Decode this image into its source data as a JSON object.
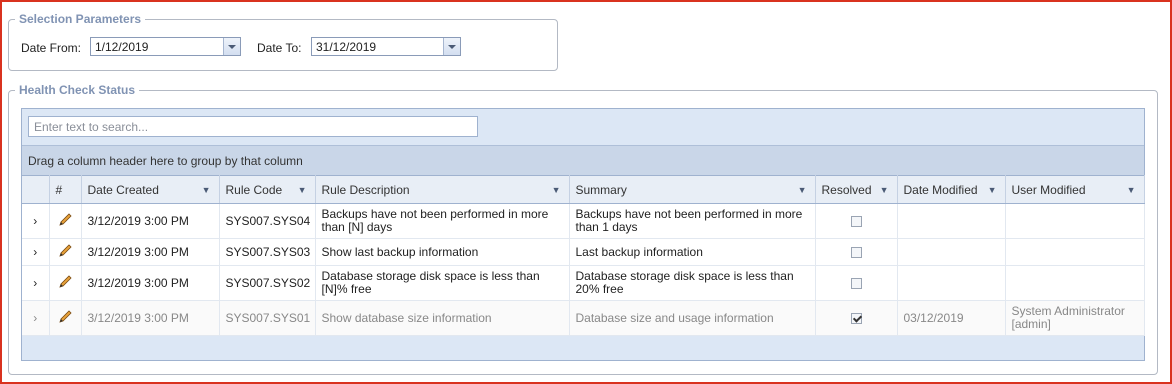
{
  "selection": {
    "legend": "Selection Parameters",
    "date_from_label": "Date From:",
    "date_from_value": "1/12/2019",
    "date_to_label": "Date To:",
    "date_to_value": "31/12/2019"
  },
  "health": {
    "legend": "Health Check Status",
    "search_placeholder": "Enter text to search...",
    "group_hint": "Drag a column header here to group by that column",
    "columns": {
      "num": "#",
      "date_created": "Date Created",
      "rule_code": "Rule Code",
      "rule_description": "Rule Description",
      "summary": "Summary",
      "resolved": "Resolved",
      "date_modified": "Date Modified",
      "user_modified": "User Modified"
    },
    "rows": [
      {
        "date_created": "3/12/2019 3:00 PM",
        "rule_code": "SYS007.SYS04",
        "rule_description": "Backups have not been performed in more than [N] days",
        "summary": "Backups have not been performed in more than 1 days",
        "resolved": false,
        "date_modified": "",
        "user_modified": ""
      },
      {
        "date_created": "3/12/2019 3:00 PM",
        "rule_code": "SYS007.SYS03",
        "rule_description": "Show last backup information",
        "summary": "Last backup information",
        "resolved": false,
        "date_modified": "",
        "user_modified": ""
      },
      {
        "date_created": "3/12/2019 3:00 PM",
        "rule_code": "SYS007.SYS02",
        "rule_description": "Database storage disk space is less than [N]% free",
        "summary": "Database storage disk space is less than 20% free",
        "resolved": false,
        "date_modified": "",
        "user_modified": ""
      },
      {
        "date_created": "3/12/2019 3:00 PM",
        "rule_code": "SYS007.SYS01",
        "rule_description": "Show database size information",
        "summary": "Database size and usage information",
        "resolved": true,
        "date_modified": "03/12/2019",
        "user_modified": "System Administrator [admin]"
      }
    ]
  },
  "icons": {
    "expand": "chevron-right-icon",
    "edit": "pencil-icon",
    "filter": "filter-icon",
    "dropdown": "chevron-down-icon"
  },
  "colors": {
    "frame_border": "#d9321f",
    "legend": "#8093b3",
    "grid_header": "#e8eef6",
    "group_panel": "#c9d6e8"
  }
}
